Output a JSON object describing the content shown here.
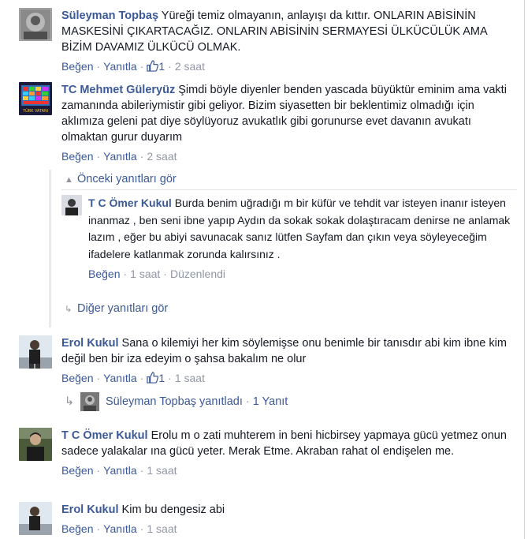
{
  "actions": {
    "like": "Beğen",
    "reply": "Yanıtla",
    "sep": "·"
  },
  "comments": [
    {
      "name": "Süleyman Topbaş",
      "text": "Yüreği temiz olmayanın, anlayışı da kıttır. ONLARIN ABİSİNİN MASKESİNİ ÇIKARTACAĞIZ. ONLARIN ABİSİNİN SERMAYESİ ÜLKÜCÜLÜK AMA BİZİM DAVAMIZ ÜLKÜCÜ OLMAK.",
      "likes": "1",
      "time": "2 saat"
    },
    {
      "name": "TC Mehmet Güleryüz",
      "text": "Şimdi böyle diyenler benden yascada büyüktür eminim ama vakti zamanında abileriymistir gibi geliyor. Bizim siyasetten bir beklentimiz olmadığı için aklımıza geleni pat diye söylüyoruz avukatlık gibi gorunurse evet davanın avukatı olmaktan gurur duyarım",
      "time": "2 saat",
      "avatar_caption": "TÜRK VATANI"
    },
    {
      "name": "Erol Kukul",
      "text": "Sana o kilemiyi her kim söylemişse onu benimle bir tanısdır abi kim ibne kim değil ben bir iza edeyim o şahsa bakalım ne olur",
      "likes": "1",
      "time": "1 saat"
    },
    {
      "name": "T C Ömer Kukul",
      "text": "Erolu m o zati muhterem in beni hicbirsey yapmaya gücü yetmez onun sadece yalakalar ına gücü yeter. Merak Etme. Akraban rahat ol endişelen me.",
      "time": "1 saat"
    },
    {
      "name": "Erol Kukul",
      "text": "Kim bu dengesiz abi",
      "time": "1 saat"
    }
  ],
  "replies": {
    "previous_label": "Önceki yanıtları gör",
    "other_label": "Diğer yanıtları gör",
    "item": {
      "name": "T C Ömer Kukul",
      "text": "Burda benim uğradığı m bir küfür ve tehdit var isteyen inanır isteyen inanmaz , ben seni ibne yapıp Aydın da sokak sokak dolaştıracam denirse ne anlamak lazım , eğer bu abiyi savunacak sanız lütfen Sayfam dan çıkın veya söyleyeceğim ifadelere katlanmak zorunda kalırsınız .",
      "like": "Beğen",
      "time": "1 saat",
      "edited": "Düzenlendi"
    },
    "summary": {
      "name": "Süleyman Topbaş",
      "replied": "yanıtladı",
      "count": "1 Yanıt"
    }
  },
  "colors": {
    "link": "#3b5998",
    "meta": "#9197a3",
    "text": "#141823"
  },
  "icons": [
    "thumbs-up-icon",
    "chevron-down-icon",
    "reply-arrow-icon"
  ]
}
